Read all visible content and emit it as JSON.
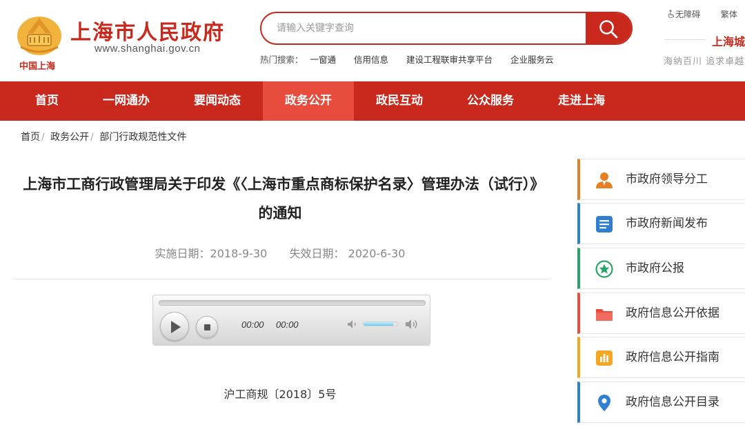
{
  "header": {
    "logo_text": "中国上海",
    "site_title": "上海市人民政府",
    "site_url": "www.shanghai.gov.cn",
    "search_placeholder": "请输入关键字查询",
    "hot_search_label": "热门搜索：",
    "hot_search_links": [
      "一窗通",
      "信用信息",
      "建设工程联审共享平台",
      "企业服务云"
    ],
    "accessibility_link": "无障碍",
    "traditional_link": "繁体",
    "city_slogan": "上海城",
    "city_slogan_sub": "海纳百川 追求卓越"
  },
  "nav": {
    "items": [
      "首页",
      "一网通办",
      "要闻动态",
      "政务公开",
      "政民互动",
      "公众服务",
      "走进上海"
    ],
    "active_index": 3
  },
  "breadcrumb": [
    "首页",
    "政务公开",
    "部门行政规范性文件"
  ],
  "article": {
    "title": "上海市工商行政管理局关于印发《〈上海市重点商标保护名录〉管理办法（试行）》的通知",
    "effective_date_label": "实施日期：",
    "effective_date": "2018-9-30",
    "expiry_date_label": "失效日期：",
    "expiry_date": "2020-6-30",
    "doc_number": "沪工商规〔2018〕5号"
  },
  "player": {
    "current_time": "00:00",
    "duration": "00:00",
    "volume": 0.85
  },
  "sidebar": {
    "items": [
      {
        "label": "市政府领导分工",
        "icon": "leader-icon",
        "color": "#e67e22"
      },
      {
        "label": "市政府新闻发布",
        "icon": "news-document-icon",
        "color": "#2f80d1"
      },
      {
        "label": "市政府公报",
        "icon": "star-badge-icon",
        "color": "#27a36a"
      },
      {
        "label": "政府信息公开依据",
        "icon": "folder-icon",
        "color": "#e74c3c"
      },
      {
        "label": "政府信息公开指南",
        "icon": "bar-chart-icon",
        "color": "#f5a623"
      },
      {
        "label": "政府信息公开目录",
        "icon": "location-pin-icon",
        "color": "#2f80d1"
      }
    ]
  },
  "colors": {
    "brand_red": "#c8291c",
    "nav_active": "#e74c3c"
  }
}
